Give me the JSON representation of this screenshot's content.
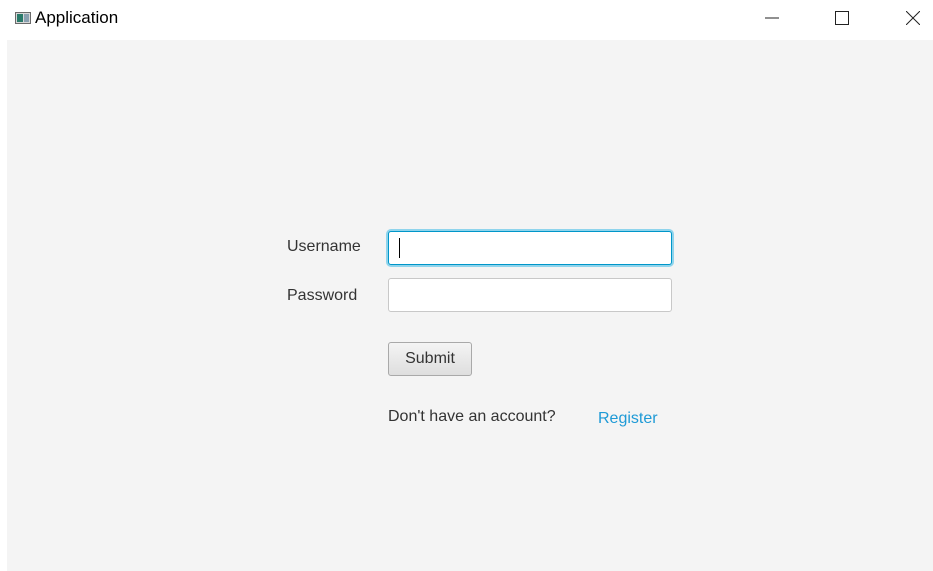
{
  "window": {
    "title": "Application",
    "icon": "app-window-icon",
    "controls": {
      "minimize_icon": "minimize-icon",
      "maximize_icon": "maximize-icon",
      "close_icon": "close-icon"
    }
  },
  "form": {
    "username_label": "Username",
    "username_value": "",
    "password_label": "Password",
    "password_value": "",
    "submit_label": "Submit",
    "prompt_text": "Don't have an account?",
    "register_link": "Register"
  },
  "colors": {
    "background": "#f4f4f4",
    "focus_border": "#0096c9",
    "link": "#1e9ad6"
  }
}
